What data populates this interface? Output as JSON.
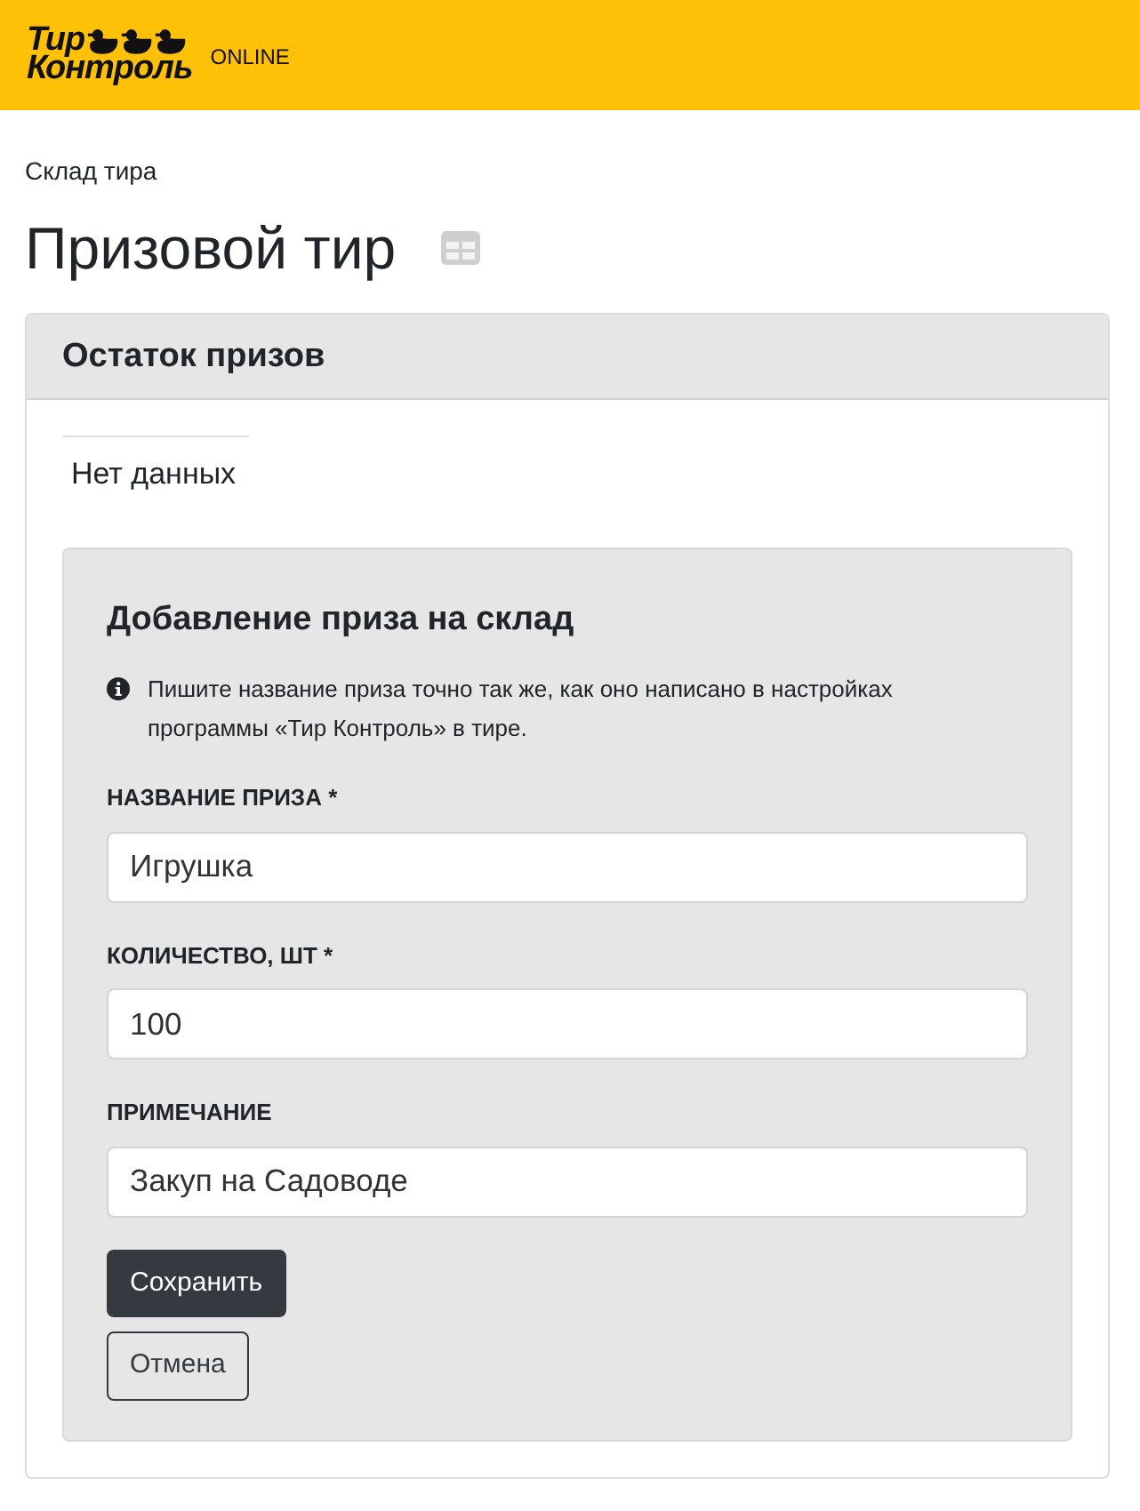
{
  "header": {
    "logo_lines": [
      "Тир",
      "Контроль"
    ],
    "tag": "ONLINE"
  },
  "breadcrumb": "Склад тира",
  "page_title": "Призовой тир",
  "card": {
    "title": "Остаток призов",
    "empty_text": "Нет данных",
    "form": {
      "title": "Добавление приза на склад",
      "info": "Пишите название приза точно так же, как оно написано в настройках программы «Тир Контроль» в тире.",
      "fields": [
        {
          "label": "НАЗВАНИЕ ПРИЗА *",
          "value": "Игрушка"
        },
        {
          "label": "КОЛИЧЕСТВО, ШТ *",
          "value": "100"
        },
        {
          "label": "ПРИМЕЧАНИЕ",
          "value": "Закуп на Садоводе"
        }
      ],
      "buttons": [
        {
          "label": "Сохранить",
          "kind": "primary"
        },
        {
          "label": "Отмена",
          "kind": "secondary"
        }
      ]
    }
  }
}
